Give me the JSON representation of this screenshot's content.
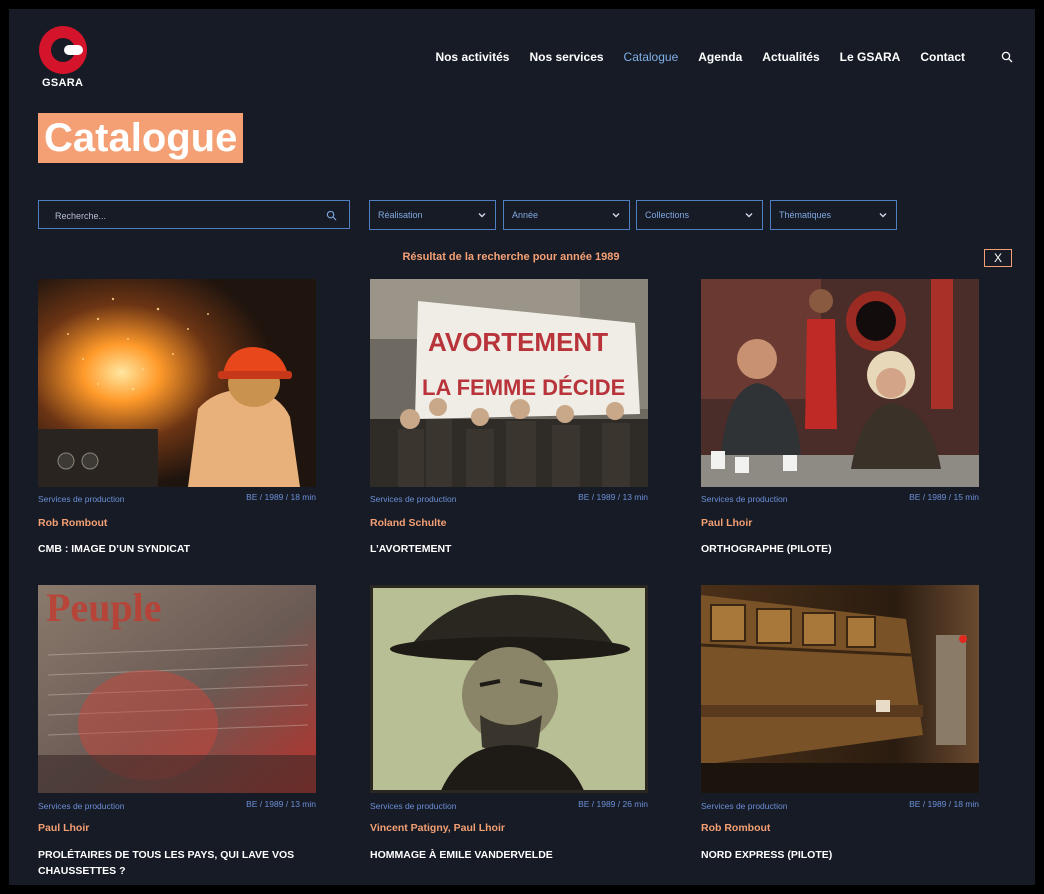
{
  "logo": {
    "text": "GSARA"
  },
  "nav": {
    "items": [
      {
        "label": "Nos activités"
      },
      {
        "label": "Nos services"
      },
      {
        "label": "Catalogue"
      },
      {
        "label": "Agenda"
      },
      {
        "label": "Actualités"
      },
      {
        "label": "Le GSARA"
      },
      {
        "label": "Contact"
      }
    ],
    "active": "Catalogue"
  },
  "page": {
    "title": "Catalogue"
  },
  "filters": {
    "search_placeholder": "Recherche...",
    "search_value": "",
    "selects": [
      {
        "label": "Réalisation"
      },
      {
        "label": "Année"
      },
      {
        "label": "Collections"
      },
      {
        "label": "Thématiques"
      }
    ]
  },
  "results": {
    "message": "Résultat de la recherche pour année 1989",
    "close_label": "X"
  },
  "colors": {
    "accent": "#f4a074",
    "link": "#6b8fd6",
    "background": "#171b26",
    "logo_red": "#d3142b"
  },
  "cards": [
    {
      "category": "Services de production",
      "info": "BE / 1989 / 18 min",
      "author": "Rob Rombout",
      "title": "CMB : IMAGE D’UN SYNDICAT",
      "image": "steel-worker-sparks"
    },
    {
      "category": "Services de production",
      "info": "BE / 1989 / 13 min",
      "author": "Roland Schulte",
      "title": "L’AVORTEMENT",
      "image": "protest-banner",
      "banner_line1": "AVORTEMENT",
      "banner_line2": "LA FEMME DÉCIDE"
    },
    {
      "category": "Services de production",
      "info": "BE / 1989 / 15 min",
      "author": "Paul Lhoir",
      "title": "ORTHOGRAPHE (PILOTE)",
      "image": "two-people-talking"
    },
    {
      "category": "Services de production",
      "info": "BE / 1989 / 13 min",
      "author": "Paul Lhoir",
      "title": "PROLÉTAIRES DE TOUS LES PAYS, QUI LAVE VOS CHAUSSETTES ?",
      "image": "newspaper-collage"
    },
    {
      "category": "Services de production",
      "info": "BE / 1989 / 26 min",
      "author": "Vincent Patigny, Paul Lhoir",
      "title": "HOMMAGE À EMILE VANDERVELDE",
      "image": "charcoal-portrait"
    },
    {
      "category": "Services de production",
      "info": "BE / 1989 / 18 min",
      "author": "Rob Rombout",
      "title": "NORD EXPRESS (PILOTE)",
      "image": "train-carriage"
    }
  ]
}
